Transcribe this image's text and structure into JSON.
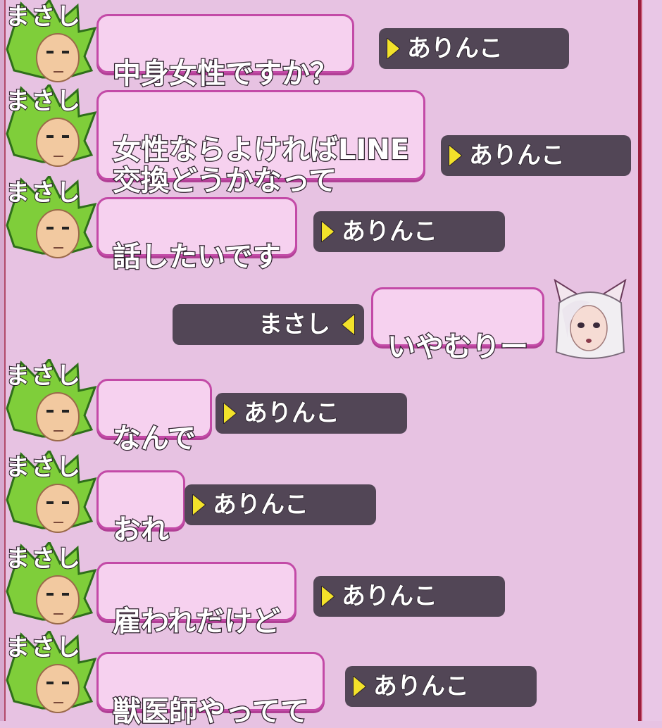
{
  "messages": [
    {
      "speaker": "まさし",
      "text": "中身女性ですか？",
      "recipient": "ありんこ"
    },
    {
      "speaker": "まさし",
      "text": "女性ならよければLINE\n交換どうかなって",
      "recipient": "ありんこ"
    },
    {
      "speaker": "まさし",
      "text": "話したいです",
      "recipient": "ありんこ"
    },
    {
      "speaker": "ありんこ",
      "text": "いやむりー",
      "recipient": "まさし"
    },
    {
      "speaker": "まさし",
      "text": "なんで",
      "recipient": "ありんこ"
    },
    {
      "speaker": "まさし",
      "text": "おれ",
      "recipient": "ありんこ"
    },
    {
      "speaker": "まさし",
      "text": "雇われだけど",
      "recipient": "ありんこ"
    },
    {
      "speaker": "まさし",
      "text": "獣医師やってて",
      "recipient": "ありんこ"
    }
  ],
  "colors": {
    "background": "#e7c2e2",
    "bubble": "#f6d1ef",
    "bubble_border": "#c34aa7",
    "tag": "#524656",
    "arrow": "#f3e22a",
    "frame": "#9a1f3e"
  },
  "icons": {
    "left_avatar": "green-spiky-hair-avatar-icon",
    "right_avatar": "catgirl-white-hair-avatar-icon",
    "arrow": "yellow-triangle-arrow-icon"
  }
}
